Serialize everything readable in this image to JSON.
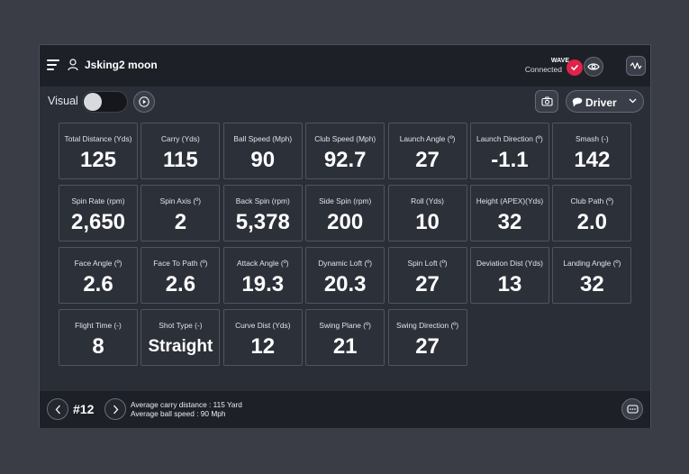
{
  "header": {
    "username": "Jsking2 moon",
    "wave_label": "WAVE",
    "wave_status": "Connected"
  },
  "toolbar": {
    "visual_label": "Visual",
    "visual_toggle_on": false,
    "club_label": "Driver"
  },
  "metrics": [
    {
      "label": "Total Distance (Yds)",
      "value": "125"
    },
    {
      "label": "Carry (Yds)",
      "value": "115"
    },
    {
      "label": "Ball Speed (Mph)",
      "value": "90"
    },
    {
      "label": "Club Speed (Mph)",
      "value": "92.7"
    },
    {
      "label": "Launch Angle (º)",
      "value": "27"
    },
    {
      "label": "Launch Direction (º)",
      "value": "-1.1"
    },
    {
      "label": "Smash (-)",
      "value": "142"
    },
    {
      "label": "Spin Rate (rpm)",
      "value": "2,650"
    },
    {
      "label": "Spin Axis (º)",
      "value": "2"
    },
    {
      "label": "Back Spin (rpm)",
      "value": "5,378"
    },
    {
      "label": "Side Spin (rpm)",
      "value": "200"
    },
    {
      "label": "Roll (Yds)",
      "value": "10"
    },
    {
      "label": "Height (APEX)(Yds)",
      "value": "32"
    },
    {
      "label": "Club Path (º)",
      "value": "2.0"
    },
    {
      "label": "Face Angle (º)",
      "value": "2.6"
    },
    {
      "label": "Face To Path (º)",
      "value": "2.6"
    },
    {
      "label": "Attack Angle (º)",
      "value": "19.3"
    },
    {
      "label": "Dynamic Loft (º)",
      "value": "20.3"
    },
    {
      "label": "Spin Loft (º)",
      "value": "27"
    },
    {
      "label": "Deviation Dist (Yds)",
      "value": "13"
    },
    {
      "label": "Landing Angle (º)",
      "value": "32"
    },
    {
      "label": "Flight Time (-)",
      "value": "8"
    },
    {
      "label": "Shot Type (-)",
      "value": "Straight"
    },
    {
      "label": "Curve Dist (Yds)",
      "value": "12"
    },
    {
      "label": "Swing Plane (º)",
      "value": "21"
    },
    {
      "label": "Swing Direction (º)",
      "value": "27"
    }
  ],
  "footer": {
    "shot_number": "#12",
    "summary_line1": "Average carry distance : 115 Yard",
    "summary_line2": "Average ball speed : 90 Mph"
  },
  "colors": {
    "accent": "#e0234a",
    "panel": "#2a2e37",
    "bar": "#1d2027",
    "backdrop": "#3a3d46"
  }
}
